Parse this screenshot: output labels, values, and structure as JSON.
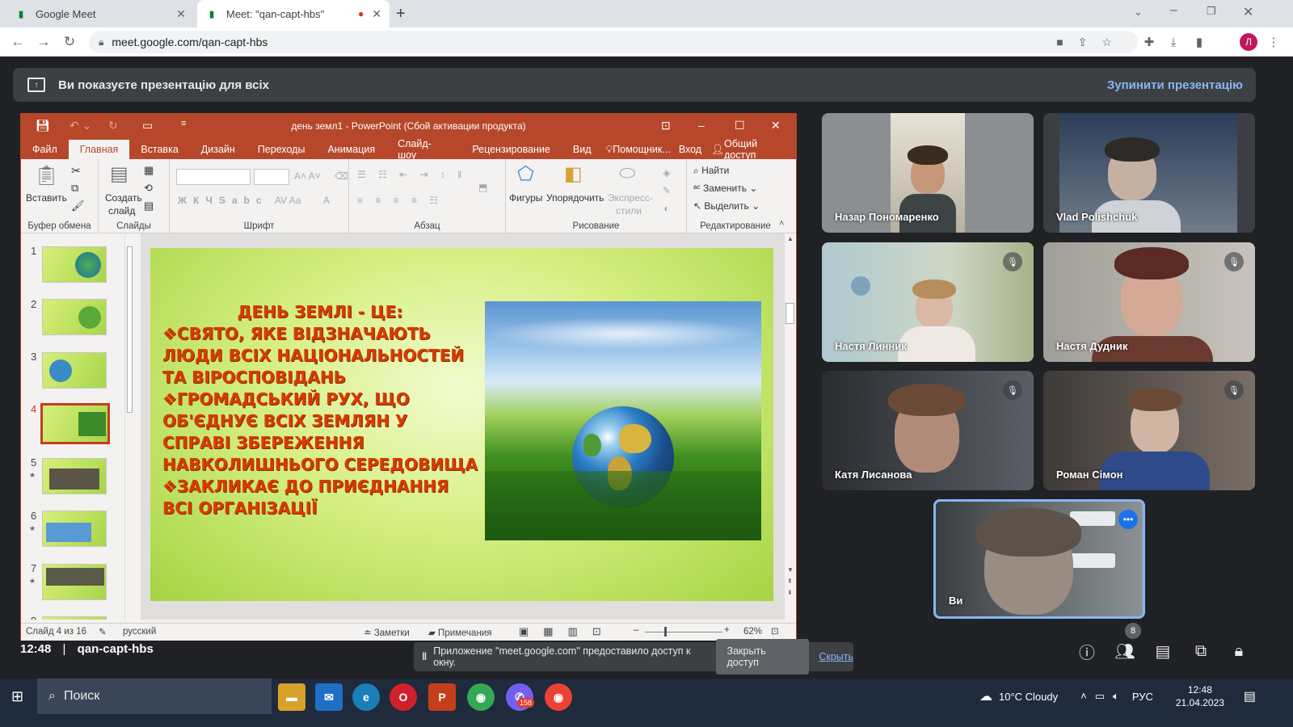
{
  "browser": {
    "tabs": [
      {
        "title": "Google Meet",
        "active": false
      },
      {
        "title": "Meet: \"qan-capt-hbs\"",
        "active": true
      }
    ],
    "url": "meet.google.com/qan-capt-hbs",
    "avatar_letter": "Л"
  },
  "banner": {
    "text": "Ви показуєте презентацію для всіх",
    "stop": "Зупинити презентацію"
  },
  "ppt": {
    "title": "день земл1 - PowerPoint (Сбой активации продукта)",
    "menu": [
      "Файл",
      "Главная",
      "Вставка",
      "Дизайн",
      "Переходы",
      "Анимация",
      "Слайд-шоу",
      "Рецензирование",
      "Вид",
      "Помощник...",
      "Вход",
      "Общий доступ"
    ],
    "ribbon": {
      "clipboard": {
        "paste": "Вставить",
        "label": "Буфер обмена"
      },
      "slides": {
        "new1": "Создать",
        "new2": "слайд",
        "label": "Слайды"
      },
      "font": {
        "label": "Шрифт"
      },
      "paragraph": {
        "label": "Абзац"
      },
      "drawing": {
        "shapes": "Фигуры",
        "arrange": "Упорядочить",
        "styles1": "Экспресс-",
        "styles2": "стили",
        "label": "Рисование"
      },
      "editing": {
        "find": "Найти",
        "replace": "Заменить",
        "select": "Выделить",
        "label": "Редактирование"
      }
    },
    "thumbs": [
      "1",
      "2",
      "3",
      "4",
      "5",
      "6",
      "7",
      "8"
    ],
    "slide": {
      "title": "ДЕНЬ ЗЕМЛІ - ЦЕ:",
      "bullets": [
        "❖СВЯТО, ЯКЕ ВІДЗНАЧАЮТЬ ЛЮДИ ВСІХ НАЦІОНАЛЬНОСТЕЙ ТА ВІРОСПОВІДАНЬ",
        "❖ГРОМАДСЬКИЙ РУХ, ЩО ОБ'ЄДНУЄ ВСІХ ЗЕМЛЯН У СПРАВІ ЗБЕРЕЖЕННЯ НАВКОЛИШНЬОГО СЕРЕДОВИЩА",
        "❖ЗАКЛИКАЄ ДО ПРИЄДНАННЯ ВСІ ОРГАНІЗАЦІЇ"
      ]
    },
    "status": {
      "slide": "Слайд 4 из 16",
      "lang": "русский",
      "notes": "Заметки",
      "comments": "Примечания",
      "zoom": "62%"
    }
  },
  "participants": [
    {
      "name": "Назар Пономаренко",
      "muted": false
    },
    {
      "name": "Vlad Polishchuk",
      "muted": false
    },
    {
      "name": "Настя Линник",
      "muted": true
    },
    {
      "name": "Настя Дудник",
      "muted": true
    },
    {
      "name": "Катя Лисанова",
      "muted": true
    },
    {
      "name": "Роман Сімон",
      "muted": true
    },
    {
      "name": "Ви",
      "muted": false
    }
  ],
  "meeting": {
    "time": "12:48",
    "code": "qan-capt-hbs",
    "participant_count": "8"
  },
  "sharebar": {
    "text": "Приложение \"meet.google.com\" предоставило доступ к окну.",
    "close": "Закрыть доступ",
    "hide": "Скрыть"
  },
  "taskbar": {
    "search": "Поиск",
    "weather": "10°C  Cloudy",
    "lang": "РУС",
    "time": "12:48",
    "date": "21.04.2023",
    "badge": "158"
  }
}
